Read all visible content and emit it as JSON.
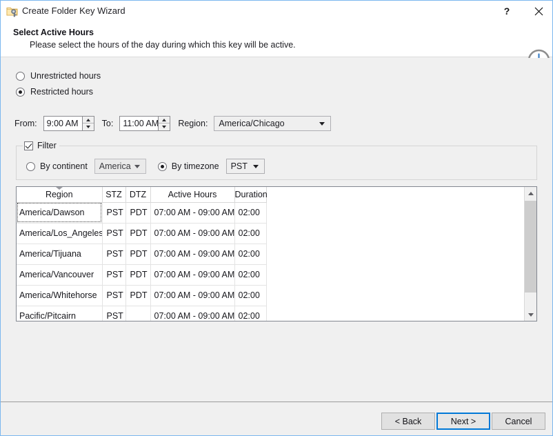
{
  "window": {
    "title": "Create Folder Key Wizard",
    "icon": "folder-key-icon",
    "help_label": "?",
    "close_label": "close-icon"
  },
  "header": {
    "title": "Select Active Hours",
    "subtitle": "Please select the hours of the day during which this key will be active.",
    "icon": "clock-icon"
  },
  "options": {
    "unrestricted_label": "Unrestricted hours",
    "restricted_label": "Restricted hours",
    "selected": "restricted"
  },
  "time_row": {
    "from_label": "From:",
    "from_value": "9:00 AM",
    "to_label": "To:",
    "to_value": "11:00 AM",
    "region_label": "Region:",
    "region_value": "America/Chicago"
  },
  "filter": {
    "legend": "Filter",
    "checked": true,
    "by_continent_label": "By continent",
    "continent_value": "America",
    "by_timezone_label": "By timezone",
    "timezone_value": "PST",
    "selected": "timezone"
  },
  "table": {
    "columns": [
      "Region",
      "STZ",
      "DTZ",
      "Active Hours",
      "Duration"
    ],
    "sort_column": "Region",
    "rows": [
      {
        "region": "America/Dawson",
        "stz": "PST",
        "dtz": "PDT",
        "hours": "07:00 AM - 09:00 AM",
        "duration": "02:00"
      },
      {
        "region": "America/Los_Angeles",
        "stz": "PST",
        "dtz": "PDT",
        "hours": "07:00 AM - 09:00 AM",
        "duration": "02:00"
      },
      {
        "region": "America/Tijuana",
        "stz": "PST",
        "dtz": "PDT",
        "hours": "07:00 AM - 09:00 AM",
        "duration": "02:00"
      },
      {
        "region": "America/Vancouver",
        "stz": "PST",
        "dtz": "PDT",
        "hours": "07:00 AM - 09:00 AM",
        "duration": "02:00"
      },
      {
        "region": "America/Whitehorse",
        "stz": "PST",
        "dtz": "PDT",
        "hours": "07:00 AM - 09:00 AM",
        "duration": "02:00"
      },
      {
        "region": "Pacific/Pitcairn",
        "stz": "PST",
        "dtz": "",
        "hours": "07:00 AM - 09:00 AM",
        "duration": "02:00"
      }
    ]
  },
  "footer": {
    "back_label": "< Back",
    "next_label": "Next >",
    "cancel_label": "Cancel"
  },
  "colors": {
    "accent": "#0078d7",
    "window_border": "#7bb7ef",
    "content_bg": "#f0f0f0"
  }
}
